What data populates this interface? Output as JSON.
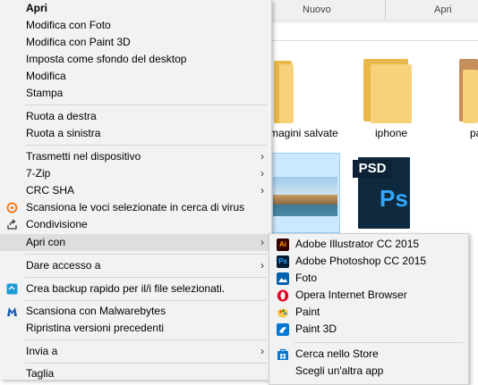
{
  "explorer": {
    "ribbon": [
      "Nuovo",
      "Apri"
    ],
    "tiles": [
      {
        "label": "magini salvate"
      },
      {
        "label": "iphone"
      },
      {
        "label": "pa"
      }
    ],
    "psd_badge": "PSD",
    "ps_badge": "Ps"
  },
  "context_menu": {
    "items": [
      {
        "label": "Apri"
      },
      {
        "label": "Modifica con Foto"
      },
      {
        "label": "Modifica con Paint 3D"
      },
      {
        "label": "Imposta come sfondo del desktop"
      },
      {
        "label": "Modifica"
      },
      {
        "label": "Stampa"
      },
      {
        "label": "Ruota a destra"
      },
      {
        "label": "Ruota a sinistra"
      },
      {
        "label": "Trasmetti nel dispositivo"
      },
      {
        "label": "7-Zip"
      },
      {
        "label": "CRC SHA"
      },
      {
        "label": "Scansiona le voci selezionate in cerca di virus"
      },
      {
        "label": "Condivisione"
      },
      {
        "label": "Apri con"
      },
      {
        "label": "Dare accesso a"
      },
      {
        "label": "Crea backup rapido per il/i file selezionati."
      },
      {
        "label": "Scansiona con Malwarebytes"
      },
      {
        "label": "Ripristina versioni precedenti"
      },
      {
        "label": "Invia a"
      },
      {
        "label": "Taglia"
      }
    ],
    "arrow": "›"
  },
  "open_with_menu": {
    "items": [
      {
        "label": "Adobe Illustrator CC 2015",
        "icon_text": "Ai"
      },
      {
        "label": "Adobe Photoshop CC 2015",
        "icon_text": "Ps"
      },
      {
        "label": "Foto"
      },
      {
        "label": "Opera Internet Browser"
      },
      {
        "label": "Paint"
      },
      {
        "label": "Paint 3D"
      },
      {
        "label": "Cerca nello Store"
      },
      {
        "label": "Scegli un'altra app"
      }
    ]
  },
  "colors": {
    "menu_bg": "#f2f2f2",
    "highlight": "#dedede",
    "illustrator": "#ff7c00",
    "photoshop": "#31a8ff",
    "folder": "#f7d27a"
  }
}
